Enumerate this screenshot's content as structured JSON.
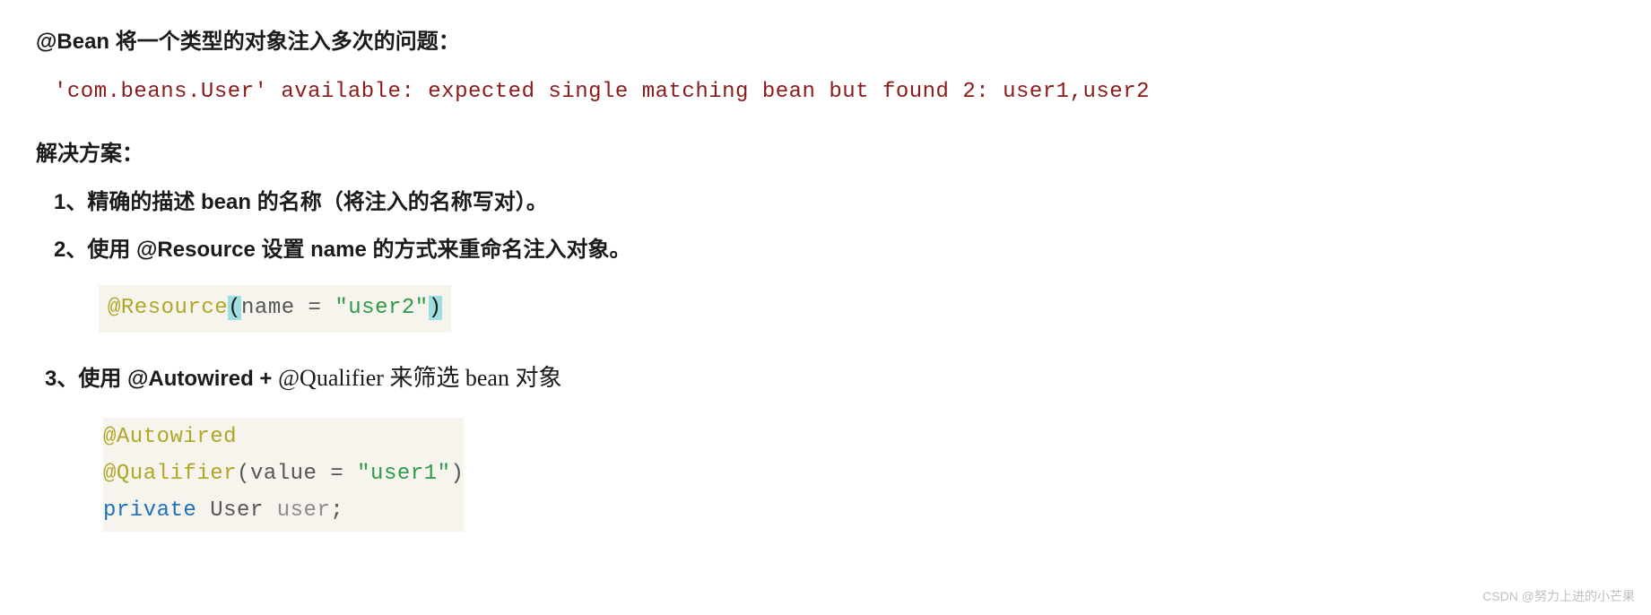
{
  "heading": "@Bean 将一个类型的对象注入多次的问题：",
  "error_line": "'com.beans.User' available: expected single matching bean but found 2: user1,user2",
  "solutions_title": "解决方案：",
  "sol1": "1、精确的描述 bean 的名称（将注入的名称写对）。",
  "sol2": "2、使用 @Resource 设置 name 的方式来重命名注入对象。",
  "code1": {
    "anno": "@Resource",
    "paren_open": "(",
    "arg_name": "name = ",
    "str": "\"user2\"",
    "paren_close": ")"
  },
  "sol3": {
    "prefix": "3、使用 @Autowired + ",
    "rest": "@Qualifier 来筛选 bean 对象"
  },
  "code2": {
    "line1_anno": "@Autowired",
    "line2_anno": "@Qualifier",
    "line2_open": "(",
    "line2_arg": "value = ",
    "line2_str": "\"user1\"",
    "line2_close": ")",
    "line3_kw": "private",
    "line3_type": " User ",
    "line3_id": "user",
    "line3_semi": ";"
  },
  "watermark": "CSDN @努力上进的小芒果"
}
